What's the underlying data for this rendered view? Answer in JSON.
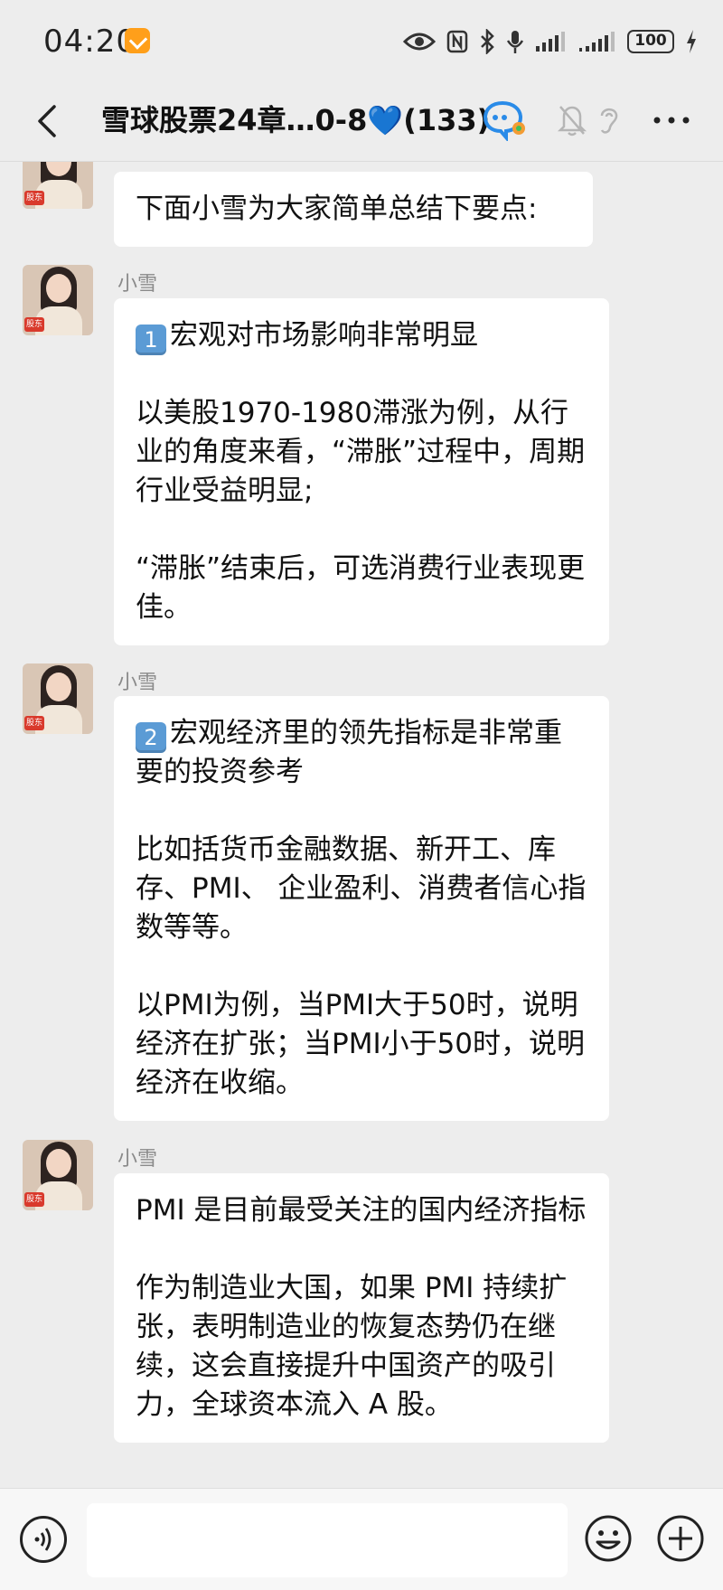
{
  "status_bar": {
    "time": "04:20",
    "battery": "100"
  },
  "header": {
    "title": "雪球股票24章…0-8💙(133)"
  },
  "messages": [
    {
      "paragraphs": [
        "下面小雪为大家简单总结下要点:"
      ]
    },
    {
      "sender": "小雪",
      "badge": "1",
      "lead": "宏观对市场影响非常明显",
      "paragraphs": [
        "以美股1970-1980滞涨为例，从行业的角度来看，“滞胀”过程中，周期行业受益明显;",
        "“滞胀”结束后，可选消费行业表现更佳。"
      ]
    },
    {
      "sender": "小雪",
      "badge": "2",
      "lead": "宏观经济里的领先指标是非常重要的投资参考",
      "paragraphs": [
        "比如括货币金融数据、新开工、库存、PMI、 企业盈利、消费者信心指数等等。",
        "以PMI为例，当PMI大于50时，说明经济在扩张；当PMI小于50时，说明经济在收缩。"
      ]
    },
    {
      "sender": "小雪",
      "paragraphs": [
        "PMI 是目前最受关注的国内经济指标",
        "作为制造业大国，如果 PMI 持续扩张，表明制造业的恢复态势仍在继续，这会直接提升中国资产的吸引力，全球资本流入 A 股。"
      ]
    }
  ],
  "avatar_tag": "股东",
  "icons": [
    "back-icon",
    "eye-icon",
    "nfc-icon",
    "bluetooth-icon",
    "mic-icon",
    "signal-icon",
    "charging-icon",
    "group-ai-icon",
    "mute-bell-icon",
    "ear-icon",
    "more-icon",
    "voice-icon",
    "emoji-icon",
    "plus-icon"
  ]
}
